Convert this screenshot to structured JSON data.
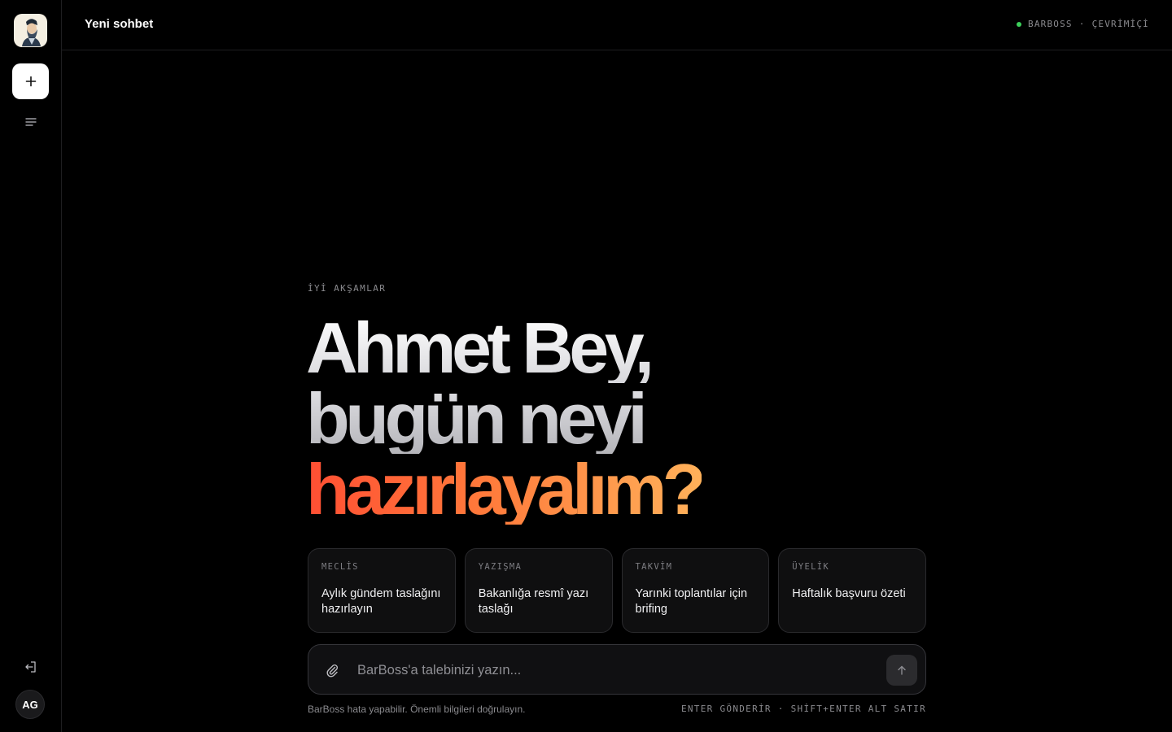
{
  "header": {
    "title": "Yeni sohbet",
    "status_brand": "BARBOSS",
    "status_sep": "·",
    "status_text": "ÇEVRİMİÇİ",
    "status_color": "#3ccf5a"
  },
  "sidebar": {
    "logo_icon": "bearded-man-logo",
    "new_chat_icon": "plus-icon",
    "history_icon": "menu-lines-icon",
    "logout_icon": "logout-icon",
    "avatar_initials": "AG"
  },
  "hero": {
    "eyebrow": "İYİ AKŞAMLAR",
    "line1": "Ahmet Bey,",
    "line2": "bugün neyi",
    "line3": "hazırlayalım?"
  },
  "cards": [
    {
      "tag": "MECLİS",
      "text": "Aylık gündem taslağını hazırlayın"
    },
    {
      "tag": "YAZIŞMA",
      "text": "Bakanlığa resmî yazı taslağı"
    },
    {
      "tag": "TAKVİM",
      "text": "Yarınki toplantılar için brifing"
    },
    {
      "tag": "ÜYELİK",
      "text": "Haftalık başvuru özeti"
    }
  ],
  "composer": {
    "placeholder": "BarBoss'a talebinizi yazın...",
    "value": "",
    "attach_icon": "paperclip-icon",
    "send_icon": "arrow-up-icon"
  },
  "footer": {
    "note": "BarBoss hata yapabilir. Önemli bilgileri doğrulayın.",
    "keys": "ENTER GÖNDERİR · SHİFT+ENTER ALT SATIR"
  },
  "colors": {
    "background": "#000000",
    "accent_start": "#ff4f33",
    "accent_end": "#ffb15a"
  }
}
